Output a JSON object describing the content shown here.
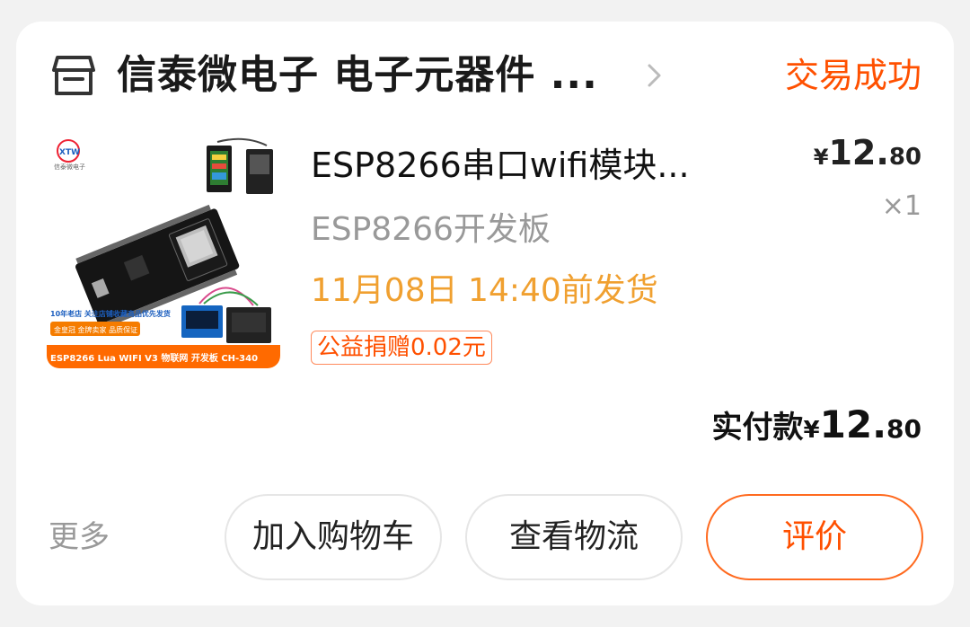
{
  "shop": {
    "icon": "store-icon",
    "name": "信泰微电子 电子元器件 ...",
    "status": "交易成功"
  },
  "product": {
    "title": "ESP8266串口wifi模块...",
    "sku": "ESP8266开发板",
    "shipping": "11月08日 14:40前发货",
    "donation": "公益捐赠0.02元",
    "price_currency": "¥",
    "price_int": "12.",
    "price_dec": "80",
    "quantity": "×1",
    "image_text": {
      "brand": "XTW",
      "brand_sub": "信泰微电子",
      "promo_line": "10年老店 关注店铺收藏商品优先发货",
      "badge": "金皇冠 金牌卖家 品质保证",
      "caption": "ESP8266 Lua WIFI V3 物联网 开发板 CH-340"
    }
  },
  "total": {
    "label": "实付款",
    "currency": "¥",
    "int": "12.",
    "dec": "80"
  },
  "actions": {
    "more": "更多",
    "add_to_cart": "加入购物车",
    "view_logistics": "查看物流",
    "review": "评价"
  },
  "colors": {
    "accent": "#ff5000",
    "shipping": "#f0a030",
    "muted": "#999999"
  }
}
